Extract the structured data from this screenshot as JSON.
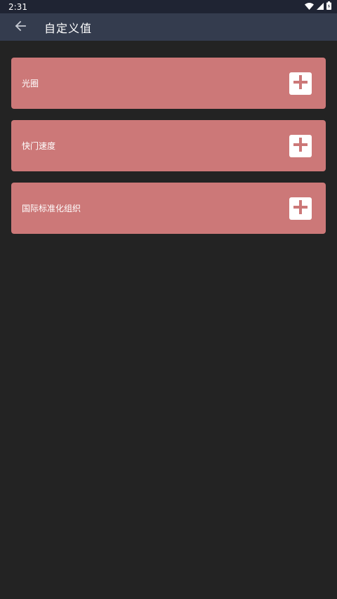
{
  "status_bar": {
    "time": "2:31",
    "icons": [
      "wifi-icon",
      "cell-signal-icon",
      "battery-icon"
    ]
  },
  "app_bar": {
    "back_icon": "arrow-left-icon",
    "title": "自定义值"
  },
  "cards": [
    {
      "label": "光圈",
      "action_icon": "plus-icon"
    },
    {
      "label": "快门速度",
      "action_icon": "plus-icon"
    },
    {
      "label": "国际标准化组织",
      "action_icon": "plus-icon"
    }
  ],
  "colors": {
    "status_bar_bg": "#1f2433",
    "app_bar_bg": "#343c4e",
    "background": "#232323",
    "card_bg": "#cc7878",
    "accent": "#cc7878"
  }
}
